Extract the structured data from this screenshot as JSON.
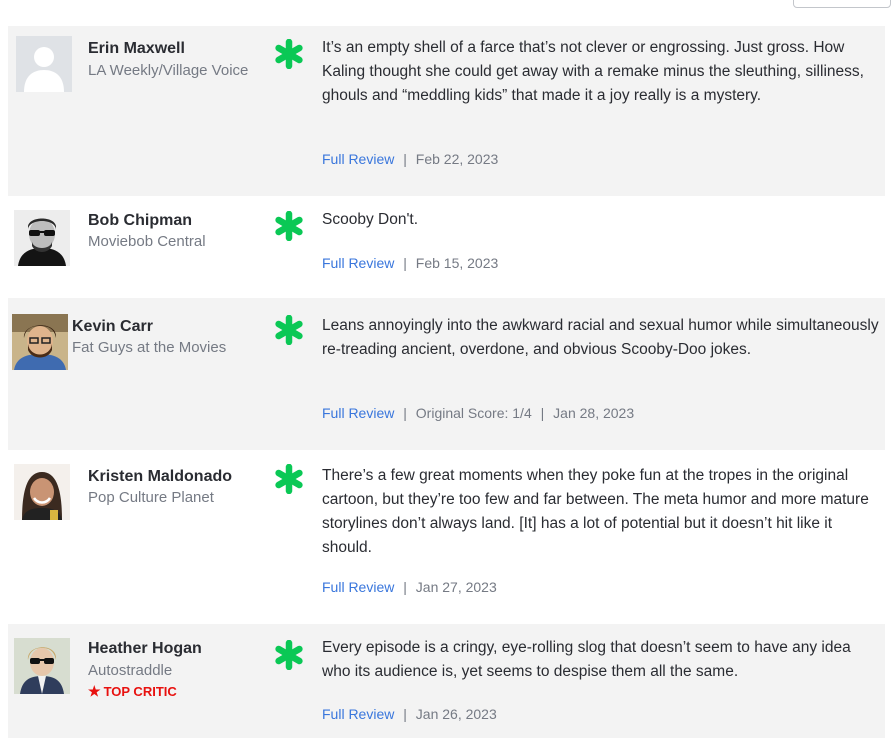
{
  "colors": {
    "row_shaded": "#f3f3f3",
    "splat_green": "#0ac855",
    "link_blue": "#3976dc",
    "top_critic_red": "#e8110f",
    "muted_text": "#757a84"
  },
  "score_icon": "green-splat-rotten-icon",
  "reviews": [
    {
      "critic": "Erin Maxwell",
      "publication": "LA Weekly/Village Voice",
      "avatar": "default-avatar-icon",
      "quote": "It’s an empty shell of a farce that’s not clever or engrossing. Just gross. How Kaling thought she could get away with a remake minus the sleuthing, silliness, ghouls and “meddling kids” that made it a joy really is a mystery.",
      "link_label": "Full Review",
      "separator": "|",
      "date": "Feb 22, 2023"
    },
    {
      "critic": "Bob Chipman",
      "publication": "Moviebob Central",
      "avatar": "critic-photo",
      "quote": "Scooby Don't.",
      "link_label": "Full Review",
      "separator": "|",
      "date": "Feb 15, 2023"
    },
    {
      "critic": "Kevin Carr",
      "publication": "Fat Guys at the Movies",
      "avatar": "critic-photo",
      "quote": "Leans annoyingly into the awkward racial and sexual humor while simultaneously re-treading ancient, overdone, and obvious Scooby-Doo jokes.",
      "link_label": "Full Review",
      "separator": "|",
      "original_score": "Original Score: 1/4",
      "separator2": "|",
      "date": "Jan 28, 2023"
    },
    {
      "critic": "Kristen Maldonado",
      "publication": "Pop Culture Planet",
      "avatar": "critic-photo",
      "quote": "There’s a few great moments when they poke fun at the tropes in the original cartoon, but they’re too few and far between. The meta humor and more mature storylines don’t always land. [It] has a lot of potential but it doesn’t hit like it should.",
      "link_label": "Full Review",
      "separator": "|",
      "date": "Jan 27, 2023"
    },
    {
      "critic": "Heather Hogan",
      "publication": "Autostraddle",
      "avatar": "critic-photo",
      "top_critic_label": "TOP CRITIC",
      "quote": "Every episode is a cringy, eye-rolling slog that doesn’t seem to have any idea who its audience is, yet seems to despise them all the same.",
      "link_label": "Full Review",
      "separator": "|",
      "date": "Jan 26, 2023"
    }
  ]
}
